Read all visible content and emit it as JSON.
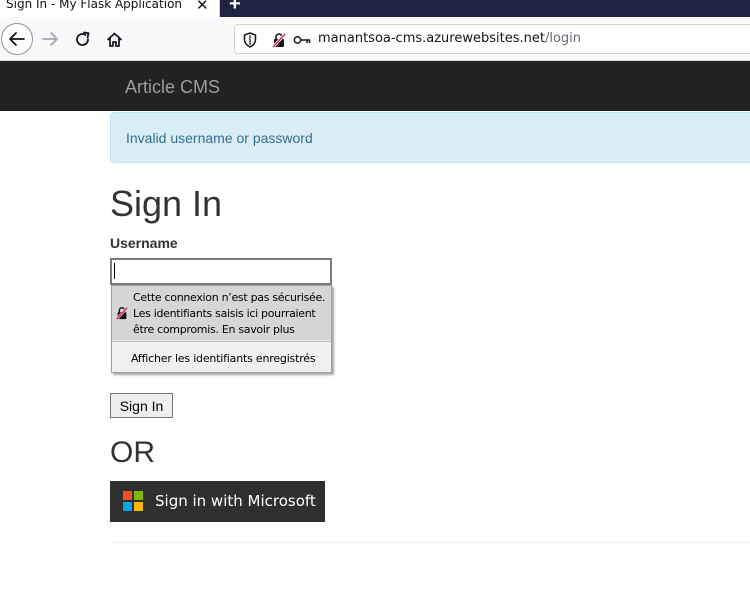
{
  "browser": {
    "tab_title": "Sign In - My Flask Application",
    "tab_close_icon": "close-icon",
    "new_tab_icon": "plus-icon",
    "url_host": "manantsoa-cms.azurewebsites.net",
    "url_path": "/login"
  },
  "navbar": {
    "brand": "Article CMS"
  },
  "alert": {
    "message": "Invalid username or password"
  },
  "form": {
    "title": "Sign In",
    "username_label": "Username",
    "username_value": "",
    "submit_label": "Sign In",
    "or_text": "OR",
    "microsoft_button": "Sign in with Microsoft"
  },
  "login_popup": {
    "warning": "Cette connexion n’est pas sécurisée. Les identifiants saisis ici pourraient être compromis.",
    "learn_more": "En savoir plus",
    "show_saved": "Afficher les identifiants enregistrés"
  },
  "colors": {
    "navbar_bg": "#222222",
    "alert_bg": "#d9edf7",
    "alert_text": "#31708f",
    "microsoft_button_bg": "#2f2f2f",
    "ms_red": "#f25022",
    "ms_green": "#7fba00",
    "ms_blue": "#00a4ef",
    "ms_yellow": "#ffb900"
  }
}
